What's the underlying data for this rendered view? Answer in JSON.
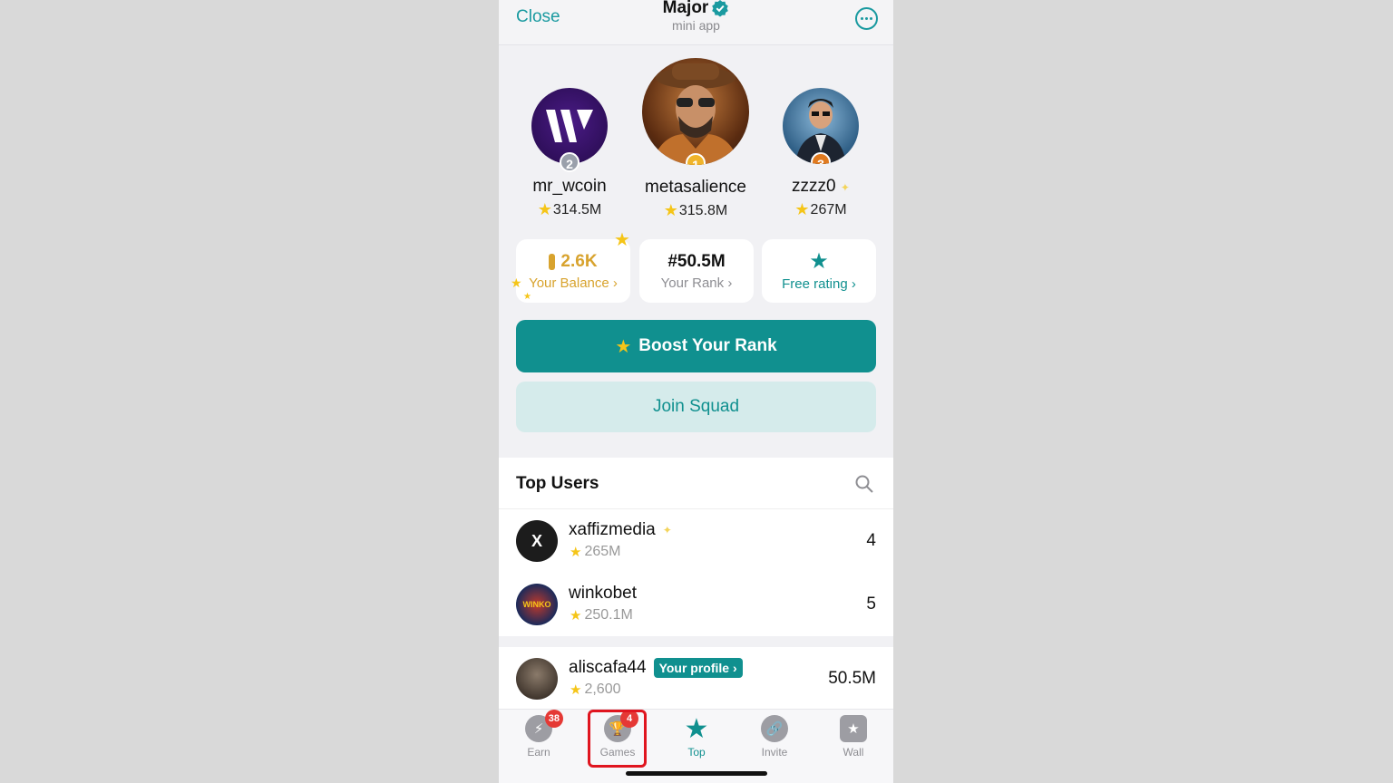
{
  "header": {
    "close_label": "Close",
    "title": "Major",
    "subtitle": "mini app",
    "more_icon": "ellipsis-circle-icon"
  },
  "podium": [
    {
      "rank": "2",
      "name": "mr_wcoin",
      "score": "314.5M"
    },
    {
      "rank": "1",
      "name": "metasalience",
      "score": "315.8M"
    },
    {
      "rank": "3",
      "name": "zzzz0",
      "score": "267M"
    }
  ],
  "cards": {
    "balance": {
      "value": "2.6K",
      "label": "Your Balance"
    },
    "rank": {
      "value": "#50.5M",
      "label": "Your Rank"
    },
    "free_rating": {
      "label": "Free rating"
    }
  },
  "buttons": {
    "boost": "Boost Your Rank",
    "squad": "Join Squad"
  },
  "top_users": {
    "title": "Top Users",
    "rows": [
      {
        "name": "xaffizmedia",
        "score": "265M",
        "rank": "4",
        "avatar_text": "X"
      },
      {
        "name": "winkobet",
        "score": "250.1M",
        "rank": "5",
        "avatar_text": "WINKO"
      }
    ],
    "self": {
      "name": "aliscafa44",
      "badge": "Your profile",
      "score": "2,600",
      "rank": "50.5M"
    }
  },
  "nav": [
    {
      "label": "Earn",
      "badge": "38",
      "icon": "lightning-icon"
    },
    {
      "label": "Games",
      "badge": "4",
      "icon": "trophy-icon"
    },
    {
      "label": "Top",
      "icon": "star-top-icon",
      "active": true
    },
    {
      "label": "Invite",
      "icon": "link-icon"
    },
    {
      "label": "Wall",
      "icon": "star-bubble-icon"
    }
  ],
  "colors": {
    "accent": "#10908f",
    "star": "#f5c518",
    "badge_red": "#e53935",
    "balance_gold": "#d8a32e"
  }
}
